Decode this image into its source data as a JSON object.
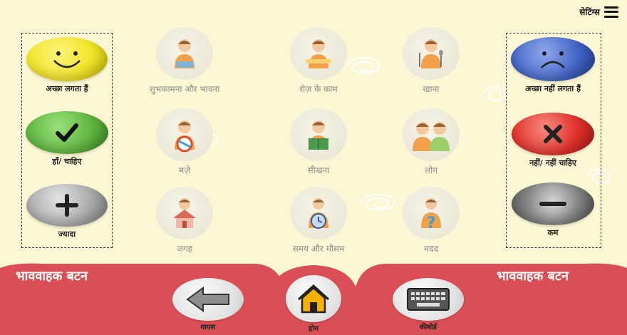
{
  "header": {
    "settings_label": "सेटिंग्स"
  },
  "left_quick": [
    {
      "label": "अच्छा लगता हैं",
      "icon": "smiley-face-icon",
      "color": "#f3e62a"
    },
    {
      "label": "हाँ/ चाहिए",
      "icon": "checkmark-icon",
      "color": "#63b843"
    },
    {
      "label": "ज्यादा",
      "icon": "plus-icon",
      "color": "#a7a7a7"
    }
  ],
  "right_quick": [
    {
      "label": "अच्छा नहीं लगता हैं",
      "icon": "sad-face-icon",
      "color": "#3f62c5"
    },
    {
      "label": "नहीं/ नहीं चाहिए",
      "icon": "cross-icon",
      "color": "#e3332d"
    },
    {
      "label": "कम",
      "icon": "minus-icon",
      "color": "#6b6b6b"
    }
  ],
  "categories": [
    {
      "label": "शुभकामना और भावना",
      "icon": "greeting-boy-icon"
    },
    {
      "label": "रोज़ के काम",
      "icon": "daily-tasks-boy-icon"
    },
    {
      "label": "खाना",
      "icon": "eating-boy-icon"
    },
    {
      "label": "मज़े",
      "icon": "ball-boy-icon"
    },
    {
      "label": "सीखना",
      "icon": "reading-boy-icon"
    },
    {
      "label": "लोग",
      "icon": "two-boys-icon"
    },
    {
      "label": "जगह",
      "icon": "house-boy-icon"
    },
    {
      "label": "समय और मौसम",
      "icon": "clock-boy-icon"
    },
    {
      "label": "मदद",
      "icon": "question-boy-icon"
    }
  ],
  "bottom": {
    "left_title": "भाववाहक बटन",
    "right_title": "भाववाहक बटन",
    "back_label": "वापस",
    "home_label": "होम",
    "keyboard_label": "कीबोर्ड"
  },
  "colors": {
    "background": "#fbf6d3",
    "bottom_bar": "#d94f55",
    "label_gray": "#8a8a8a"
  }
}
